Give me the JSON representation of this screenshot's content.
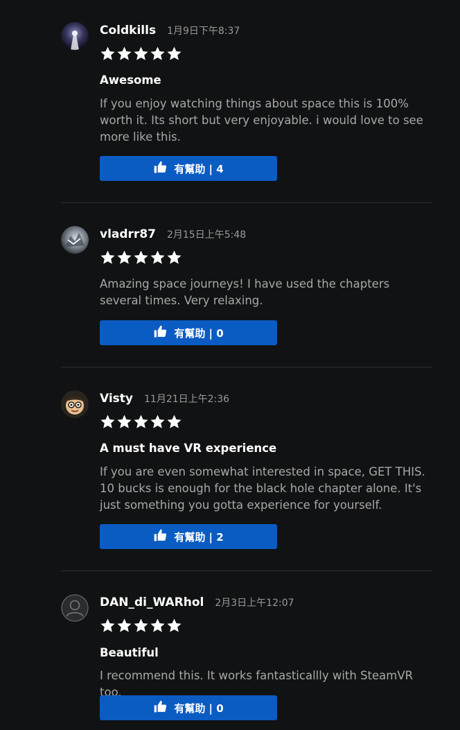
{
  "reviews": [
    {
      "username": "Coldkills",
      "date": "1月9日下午8:37",
      "title": "Awesome",
      "body": "If you enjoy watching things about space this is 100% worth it. Its short but very enjoyable. i would love to see more like this.",
      "helpful_label": "有幫助 | 4"
    },
    {
      "username": "vladrr87",
      "date": "2月15日上午5:48",
      "title": "",
      "body": "Amazing space journeys! I have used the chapters several times. Very relaxing.",
      "helpful_label": "有幫助 | 0"
    },
    {
      "username": "Visty",
      "date": "11月21日上午2:36",
      "title": "A must have VR experience",
      "body": "If you are even somewhat interested in space, GET THIS. 10 bucks is enough for the black hole chapter alone. It's just something you gotta experience for yourself.",
      "helpful_label": "有幫助 | 2"
    },
    {
      "username": "DAN_di_WARhol",
      "date": "2月3日上午12:07",
      "title": "Beautiful",
      "body": "I recommend this. It works fantasticallly with SteamVR too.",
      "helpful_label": "有幫助 | 0"
    }
  ],
  "star_rating": 5,
  "colors": {
    "background": "#111213",
    "button": "#0b5cc2",
    "body_text": "#a8a8a8",
    "date_text": "#9a9a9a",
    "divider": "#2e2f31"
  },
  "icons": {
    "rating": "star-icon",
    "helpful": "thumbs-up-icon",
    "default_avatar": "user-icon"
  }
}
